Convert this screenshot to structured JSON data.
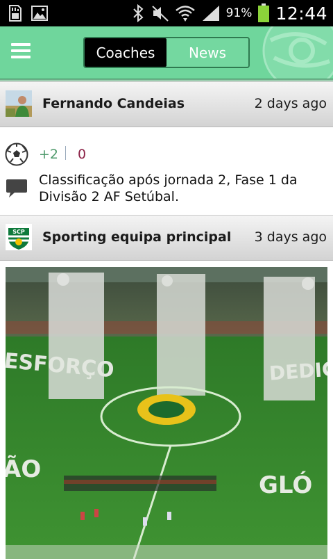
{
  "status_bar": {
    "battery_percent": "91%",
    "time": "12:44"
  },
  "header": {
    "tabs": [
      {
        "label": "Coaches",
        "selected": true
      },
      {
        "label": "News",
        "selected": false
      }
    ]
  },
  "posts": [
    {
      "author": "Fernando Candeias",
      "time": "2 days ago",
      "score_plus": "+2",
      "score_minus": "0",
      "text": "Classificação após jornada 2, Fase 1 da Divisão 2 AF Setúbal."
    },
    {
      "author": "Sporting equipa principal",
      "time": "3 days ago",
      "avatar_text": "SCP",
      "image_text": [
        "ESFORÇO",
        "DEDIC",
        "ÃO",
        "GLÓ"
      ]
    }
  ],
  "colors": {
    "header_green": "#6fd69c",
    "plus_green": "#4f9a6c",
    "minus_red": "#8b2146"
  }
}
